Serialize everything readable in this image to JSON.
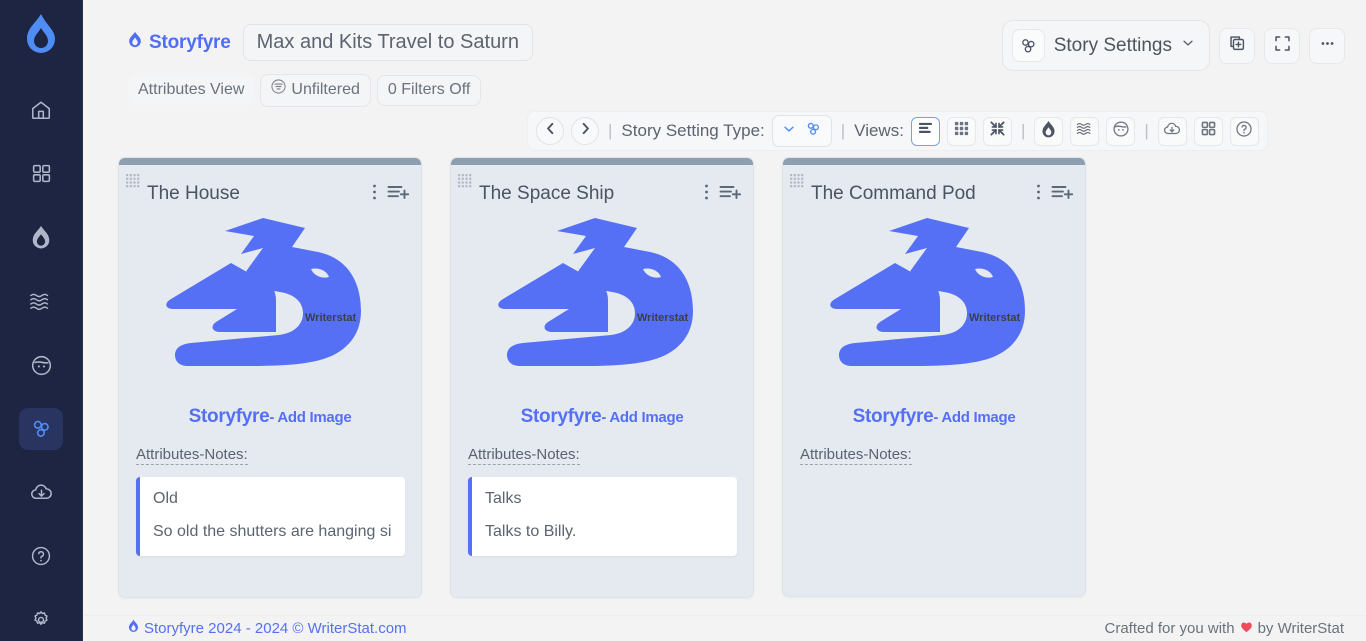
{
  "brand": {
    "name": "Storyfyre",
    "accent": "#4f6df5"
  },
  "header": {
    "story_title": "Max and Kits Travel to Saturn",
    "view_label": "Attributes View",
    "filter_label": "Unfiltered",
    "filters_off_label": "0 Filters Off",
    "settings_label": "Story Settings"
  },
  "toolbar": {
    "type_label": "Story Setting Type:",
    "views_label": "Views:",
    "separator": "|"
  },
  "cards": [
    {
      "title": "The House",
      "logo_caption_bold": "Storyfyre",
      "logo_caption_rest": "- Add Image",
      "logo_watermark": "Writerstat",
      "attributes_label": "Attributes-Notes:",
      "notes": [
        "Old",
        "So old the shutters are hanging si"
      ]
    },
    {
      "title": "The Space Ship",
      "logo_caption_bold": "Storyfyre",
      "logo_caption_rest": "- Add Image",
      "logo_watermark": "Writerstat",
      "attributes_label": "Attributes-Notes:",
      "notes": [
        "Talks",
        "Talks to Billy."
      ]
    },
    {
      "title": "The Command Pod",
      "logo_caption_bold": "Storyfyre",
      "logo_caption_rest": "- Add Image",
      "logo_watermark": "Writerstat",
      "attributes_label": "Attributes-Notes:",
      "notes": []
    }
  ],
  "sidebar": {
    "items": [
      {
        "icon": "home-icon",
        "active": false
      },
      {
        "icon": "dashboard-grid-icon",
        "active": false
      },
      {
        "icon": "flame-icon",
        "active": false
      },
      {
        "icon": "waves-icon",
        "active": false
      },
      {
        "icon": "face-icon",
        "active": false
      },
      {
        "icon": "molecule-icon",
        "active": true
      },
      {
        "icon": "cloud-download-icon",
        "active": false
      },
      {
        "icon": "help-circle-icon",
        "active": false
      },
      {
        "icon": "gear-icon",
        "active": false
      }
    ]
  },
  "footer": {
    "copyright": "Storyfyre 2024 - 2024 © WriterStat.com",
    "crafted_prefix": "Crafted for you with",
    "crafted_suffix": "by WriterStat"
  }
}
